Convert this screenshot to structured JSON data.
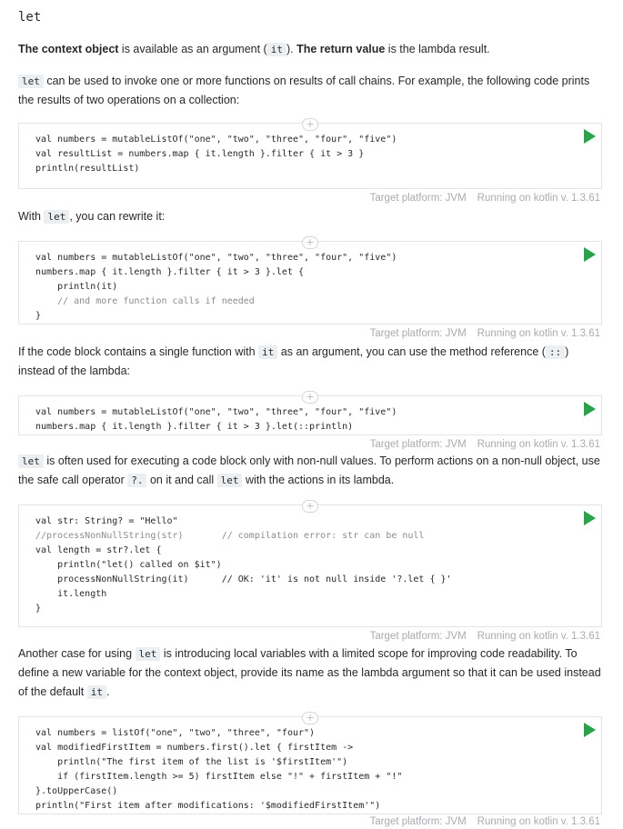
{
  "heading": "let",
  "para1": {
    "b1": "The context object",
    "t1": " is available as an argument (",
    "code1": "it",
    "t2": "). ",
    "b2": "The return value",
    "t3": " is the lambda result."
  },
  "para2": {
    "code1": "let",
    "t1": " can be used to invoke one or more functions on results of call chains. For example, the following code prints the results of two operations on a collection:"
  },
  "para3": {
    "t1": "With ",
    "code1": "let",
    "t2": ", you can rewrite it:"
  },
  "para4": {
    "t1": "If the code block contains a single function with ",
    "code1": "it",
    "t2": " as an argument, you can use the method reference (",
    "code2": "::",
    "t3": ") instead of the lambda:"
  },
  "para5": {
    "code1": "let",
    "t1": " is often used for executing a code block only with non-null values. To perform actions on a non-null object, use the safe call operator ",
    "code2": "?.",
    "t2": " on it and call ",
    "code3": "let",
    "t3": " with the actions in its lambda."
  },
  "para6": {
    "t1": "Another case for using ",
    "code1": "let",
    "t2": " is introducing local variables with a limited scope for improving code readability. To define a new variable for the context object, provide its name as the lambda argument so that it can be used instead of the default ",
    "code2": "it",
    "t3": "."
  },
  "meta": {
    "platform": "Target platform: JVM",
    "running": "Running on kotlin v. 1.3.61"
  },
  "plus_glyph": "+",
  "code": {
    "b1": [
      "val numbers = mutableListOf(\"one\", \"two\", \"three\", \"four\", \"five\")",
      "val resultList = numbers.map { it.length }.filter { it > 3 }",
      "println(resultList)"
    ],
    "b2": [
      "val numbers = mutableListOf(\"one\", \"two\", \"three\", \"four\", \"five\")",
      "numbers.map { it.length }.filter { it > 3 }.let {",
      "    println(it)",
      "    // and more function calls if needed",
      "}"
    ],
    "b3": [
      "val numbers = mutableListOf(\"one\", \"two\", \"three\", \"four\", \"five\")",
      "numbers.map { it.length }.filter { it > 3 }.let(::println)"
    ],
    "b4": [
      "val str: String? = \"Hello\"",
      "//processNonNullString(str)       // compilation error: str can be null",
      "val length = str?.let {",
      "    println(\"let() called on $it\")",
      "    processNonNullString(it)      // OK: 'it' is not null inside '?.let { }'",
      "    it.length",
      "}"
    ],
    "b5": [
      "val numbers = listOf(\"one\", \"two\", \"three\", \"four\")",
      "val modifiedFirstItem = numbers.first().let { firstItem ->",
      "    println(\"The first item of the list is '$firstItem'\")",
      "    if (firstItem.length >= 5) firstItem else \"!\" + firstItem + \"!\"",
      "}.toUpperCase()",
      "println(\"First item after modifications: '$modifiedFirstItem'\")"
    ]
  }
}
